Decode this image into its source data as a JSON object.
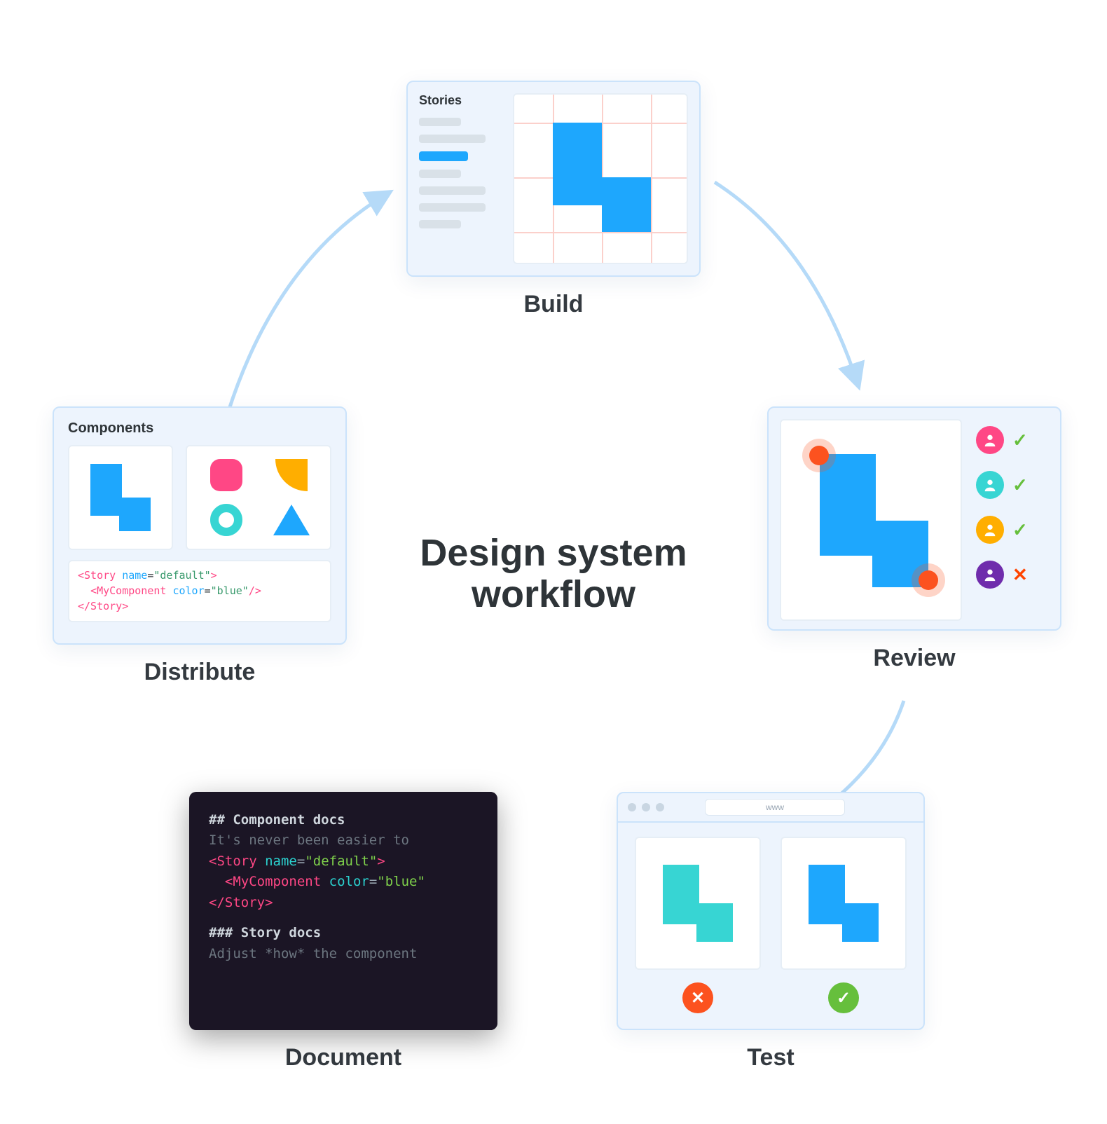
{
  "center": {
    "line1": "Design system",
    "line2": "workflow"
  },
  "build": {
    "label": "Build",
    "panelTitle": "Stories"
  },
  "review": {
    "label": "Review",
    "users": [
      {
        "color": "#FF4785",
        "status": "check"
      },
      {
        "color": "#37D5D3",
        "status": "check"
      },
      {
        "color": "#FFAE00",
        "status": "check"
      },
      {
        "color": "#6F2CAC",
        "status": "x"
      }
    ]
  },
  "test": {
    "label": "Test",
    "url": "www",
    "left": {
      "color": "#37D5D3",
      "result": "fail"
    },
    "right": {
      "color": "#1EA7FD",
      "result": "pass"
    }
  },
  "document": {
    "label": "Document",
    "lines": {
      "h1": "## Component docs",
      "p1": "It's never been easier to",
      "open": "<Story",
      "nameAttr": "name",
      "nameVal": "\"default\"",
      "childOpen": "<MyComponent",
      "colorAttr": "color",
      "colorVal": "\"blue\"",
      "close": "</Story>",
      "h2": "### Story docs",
      "p2": "Adjust *how* the component"
    }
  },
  "distribute": {
    "label": "Distribute",
    "panelTitle": "Components",
    "code": {
      "open": "<Story",
      "nameAttr": "name",
      "nameVal": "\"default\"",
      "childOpen": "<MyComponent",
      "colorAttr": "color",
      "colorVal": "\"blue\"",
      "close": "</Story>"
    }
  }
}
